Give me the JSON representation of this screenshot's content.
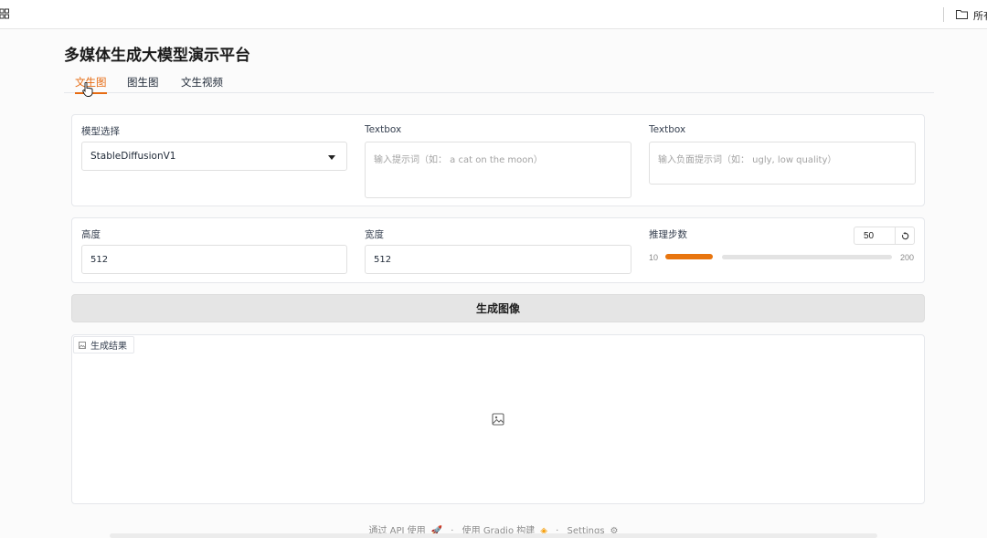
{
  "topbar": {
    "right_text": "所有"
  },
  "app": {
    "title": "多媒体生成大模型演示平台"
  },
  "tabs": [
    {
      "label": "文生图",
      "active": true
    },
    {
      "label": "图生图",
      "active": false
    },
    {
      "label": "文生视频",
      "active": false
    }
  ],
  "prompt_panel": {
    "model_label": "模型选择",
    "model_value": "StableDiffusionV1",
    "prompt_label": "Textbox",
    "prompt_placeholder": "输入提示词（如： a cat on the moon）",
    "negative_label": "Textbox",
    "negative_placeholder": "输入负面提示词（如： ugly, low quality）"
  },
  "params_panel": {
    "height_label": "高度",
    "height_value": "512",
    "width_label": "宽度",
    "width_value": "512",
    "steps_label": "推理步数",
    "steps_value": "50",
    "steps_min": "10",
    "steps_max": "200",
    "steps_fraction": 0.21
  },
  "generate_button": {
    "label": "生成图像"
  },
  "result": {
    "label": "生成结果"
  },
  "footer": {
    "api": "通过 API 使用",
    "sep": "·",
    "built": "使用 Gradio 构建",
    "settings": "Settings"
  },
  "colors": {
    "accent": "#e66b12",
    "slider": "#e8750f",
    "button_bg": "#e5e5e5"
  },
  "icons": [
    "grid-icon",
    "folder-icon",
    "mouse-cursor-icon",
    "dropdown-caret-icon",
    "reset-icon",
    "image-icon",
    "rocket-icon",
    "gradio-logo-icon",
    "gear-icon"
  ]
}
